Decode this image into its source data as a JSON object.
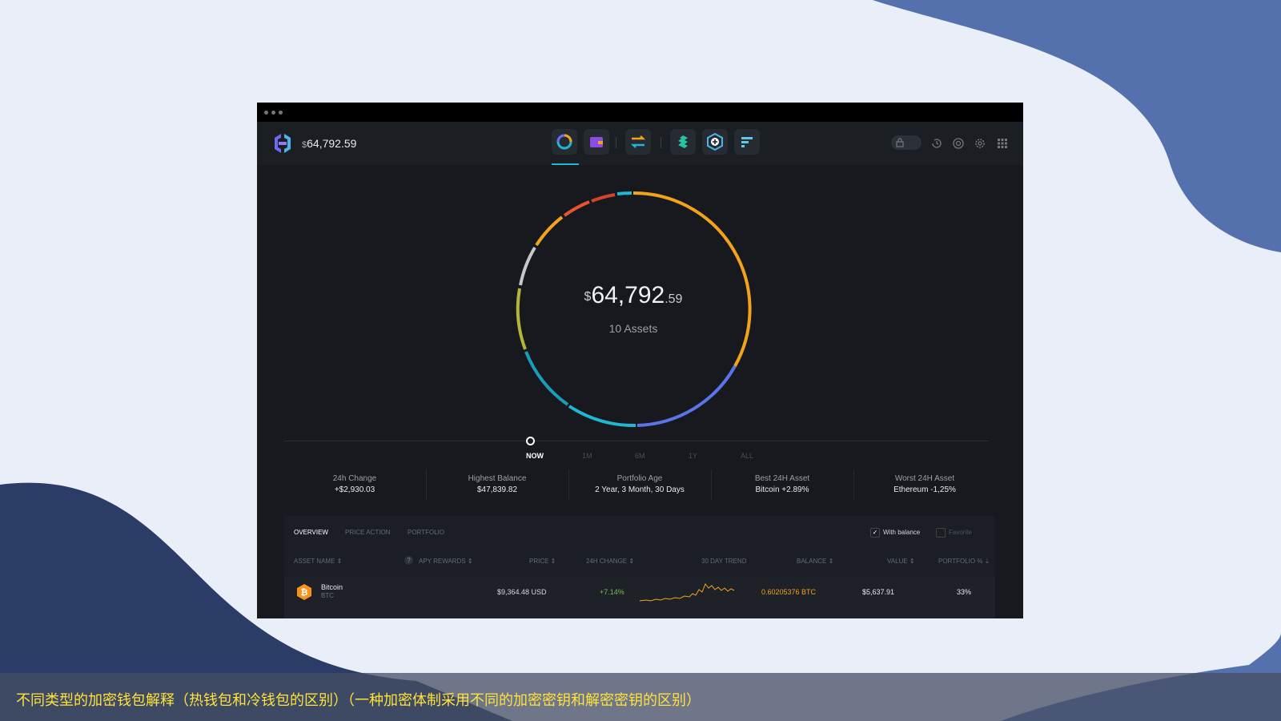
{
  "header": {
    "currency_symbol": "$",
    "balance": "64,792.59"
  },
  "donut": {
    "currency_symbol": "$",
    "value_int": "64,792",
    "value_dec": ".59",
    "assets_label": "10 Assets"
  },
  "timeline": [
    "NOW",
    "1M",
    "6M",
    "1Y",
    "ALL"
  ],
  "stats": [
    {
      "label": "24h Change",
      "value": "+$2,930.03"
    },
    {
      "label": "Highest Balance",
      "value": "$47,839.82"
    },
    {
      "label": "Portfolio Age",
      "value": "2 Year, 3 Month, 30 Days"
    },
    {
      "label": "Best 24H Asset",
      "value": "Bitcoin +2.89%"
    },
    {
      "label": "Worst 24H Asset",
      "value": "Ethereum -1,25%"
    }
  ],
  "tabs": [
    "OVERVIEW",
    "PRICE ACTION",
    "PORTFOLIO"
  ],
  "filters": {
    "with_balance": "With balance",
    "favorite": "Favorite"
  },
  "columns": [
    "ASSET NAME ⇕",
    "APY REWARDS ⇕",
    "PRICE ⇕",
    "24H CHANGE ⇕",
    "30 DAY TREND",
    "BALANCE ⇕",
    "VALUE ⇕",
    "PORTFOLIO % ⇣"
  ],
  "rows": [
    {
      "name": "Bitcoin",
      "ticker": "BTC",
      "price": "$9,364.48 USD",
      "change": "+7.14%",
      "balance": "0.60205376 BTC",
      "value": "$5,637.91",
      "portfolio": "33%"
    }
  ],
  "caption": "不同类型的加密钱包解释（热钱包和冷钱包的区别）（一种加密体制采用不同的加密密钥和解密密钥的区别）",
  "colors": {
    "accent": "#1fb7d4",
    "bitcoin": "#f7931a",
    "balance": "#f2a31b",
    "positive": "#6fbf5a"
  }
}
